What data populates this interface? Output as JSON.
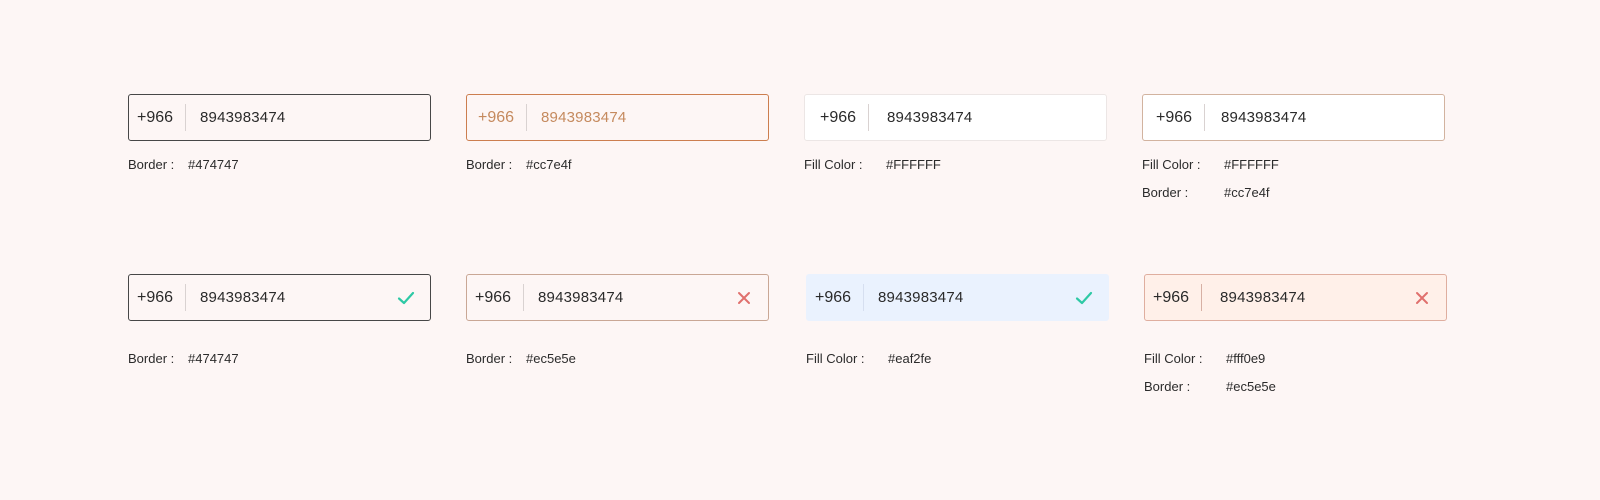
{
  "colors": {
    "dark_border": "#474747",
    "accent_border": "#cc7e4f",
    "error_border": "#ec5e5e",
    "white_fill": "#FFFFFF",
    "success_fill": "#eaf2fe",
    "error_fill": "#fff0e9",
    "success_icon": "#2ec9a5",
    "error_icon": "#e0706d"
  },
  "variants": [
    {
      "code": "+966",
      "phone": "8943983474",
      "labels": [
        {
          "key": "Border :",
          "value": "#474747"
        }
      ]
    },
    {
      "code": "+966",
      "phone": "8943983474",
      "labels": [
        {
          "key": "Border :",
          "value": "#cc7e4f"
        }
      ]
    },
    {
      "code": "+966",
      "phone": "8943983474",
      "labels": [
        {
          "key": "Fill Color :",
          "value": "#FFFFFF"
        }
      ]
    },
    {
      "code": "+966",
      "phone": "8943983474",
      "labels": [
        {
          "key": "Fill Color :",
          "value": "#FFFFFF"
        },
        {
          "key": "Border :",
          "value": "#cc7e4f"
        }
      ]
    },
    {
      "code": "+966",
      "phone": "8943983474",
      "status_icon": "check-icon",
      "labels": [
        {
          "key": "Border :",
          "value": "#474747"
        }
      ]
    },
    {
      "code": "+966",
      "phone": "8943983474",
      "status_icon": "close-icon",
      "labels": [
        {
          "key": "Border :",
          "value": "#ec5e5e"
        }
      ]
    },
    {
      "code": "+966",
      "phone": "8943983474",
      "status_icon": "check-icon",
      "labels": [
        {
          "key": "Fill Color :",
          "value": "#eaf2fe"
        }
      ]
    },
    {
      "code": "+966",
      "phone": "8943983474",
      "status_icon": "close-icon",
      "labels": [
        {
          "key": "Fill Color :",
          "value": "#fff0e9"
        },
        {
          "key": "Border :",
          "value": "#ec5e5e"
        }
      ]
    }
  ]
}
